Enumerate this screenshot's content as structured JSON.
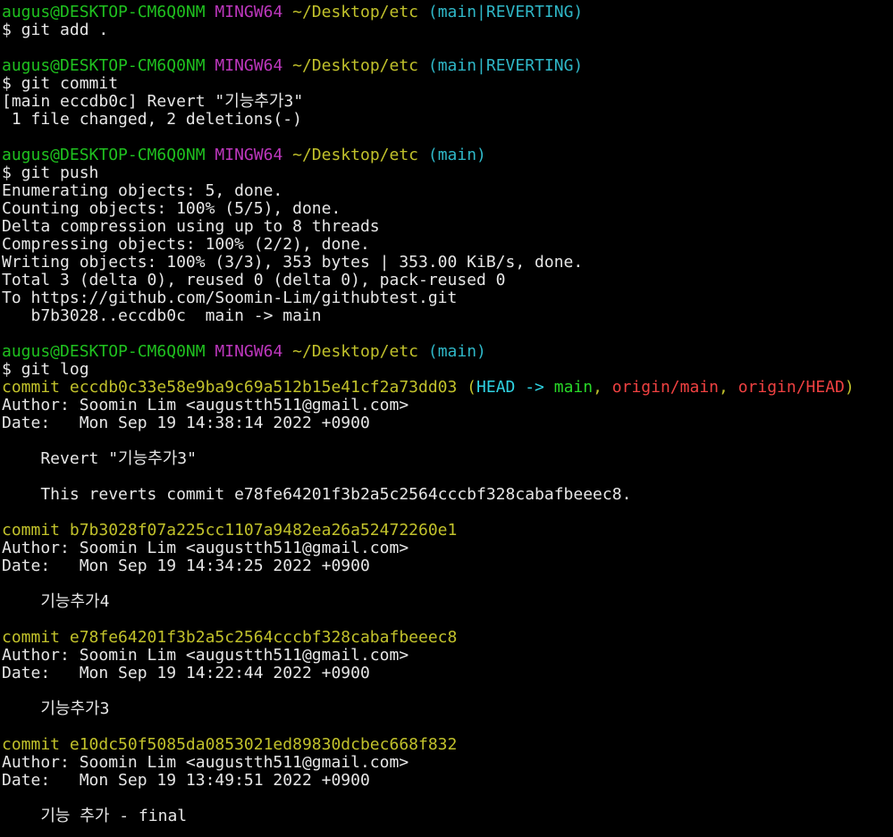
{
  "colors": {
    "user": "#1fc11f",
    "host": "#bd37bd",
    "path": "#c1c12b",
    "branch": "#2fb7c7",
    "hash": "#c1c12b",
    "text": "#e6e6e6",
    "head": "#2fd3e3",
    "local_branch": "#28d728",
    "remote_branch": "#ef4141",
    "background": "#000000"
  },
  "lines": [
    {
      "type": "prompt",
      "user": "augus@DESKTOP-CM6Q0NM",
      "host": "MINGW64",
      "path": "~/Desktop/etc",
      "branch": "(main|REVERTING)"
    },
    {
      "type": "text",
      "text": "$ git add ."
    },
    {
      "type": "blank"
    },
    {
      "type": "prompt",
      "user": "augus@DESKTOP-CM6Q0NM",
      "host": "MINGW64",
      "path": "~/Desktop/etc",
      "branch": "(main|REVERTING)"
    },
    {
      "type": "text",
      "text": "$ git commit"
    },
    {
      "type": "text",
      "text": "[main eccdb0c] Revert \"기능추가3\""
    },
    {
      "type": "text",
      "text": " 1 file changed, 2 deletions(-)"
    },
    {
      "type": "blank"
    },
    {
      "type": "prompt",
      "user": "augus@DESKTOP-CM6Q0NM",
      "host": "MINGW64",
      "path": "~/Desktop/etc",
      "branch": "(main)"
    },
    {
      "type": "text",
      "text": "$ git push"
    },
    {
      "type": "text",
      "text": "Enumerating objects: 5, done."
    },
    {
      "type": "text",
      "text": "Counting objects: 100% (5/5), done."
    },
    {
      "type": "text",
      "text": "Delta compression using up to 8 threads"
    },
    {
      "type": "text",
      "text": "Compressing objects: 100% (2/2), done."
    },
    {
      "type": "text",
      "text": "Writing objects: 100% (3/3), 353 bytes | 353.00 KiB/s, done."
    },
    {
      "type": "text",
      "text": "Total 3 (delta 0), reused 0 (delta 0), pack-reused 0"
    },
    {
      "type": "text",
      "text": "To https://github.com/Soomin-Lim/githubtest.git"
    },
    {
      "type": "text",
      "text": "   b7b3028..eccdb0c  main -> main"
    },
    {
      "type": "blank"
    },
    {
      "type": "prompt",
      "user": "augus@DESKTOP-CM6Q0NM",
      "host": "MINGW64",
      "path": "~/Desktop/etc",
      "branch": "(main)"
    },
    {
      "type": "text",
      "text": "$ git log"
    },
    {
      "type": "commit_head",
      "label": "commit eccdb0c33e58e9ba9c69a512b15e41cf2a73dd03",
      "open": " (",
      "head": "HEAD -> ",
      "local": "main",
      "sep1": ", ",
      "remote1": "origin/main",
      "sep2": ", ",
      "remote2": "origin/HEAD",
      "close": ")"
    },
    {
      "type": "text",
      "text": "Author: Soomin Lim <augustth511@gmail.com>"
    },
    {
      "type": "text",
      "text": "Date:   Mon Sep 19 14:38:14 2022 +0900"
    },
    {
      "type": "blank"
    },
    {
      "type": "text",
      "text": "    Revert \"기능추가3\""
    },
    {
      "type": "blank"
    },
    {
      "type": "text",
      "text": "    This reverts commit e78fe64201f3b2a5c2564cccbf328cabafbeeec8."
    },
    {
      "type": "blank"
    },
    {
      "type": "commit",
      "label": "commit b7b3028f07a225cc1107a9482ea26a52472260e1"
    },
    {
      "type": "text",
      "text": "Author: Soomin Lim <augustth511@gmail.com>"
    },
    {
      "type": "text",
      "text": "Date:   Mon Sep 19 14:34:25 2022 +0900"
    },
    {
      "type": "blank"
    },
    {
      "type": "text",
      "text": "    기능추가4"
    },
    {
      "type": "blank"
    },
    {
      "type": "commit",
      "label": "commit e78fe64201f3b2a5c2564cccbf328cabafbeeec8"
    },
    {
      "type": "text",
      "text": "Author: Soomin Lim <augustth511@gmail.com>"
    },
    {
      "type": "text",
      "text": "Date:   Mon Sep 19 14:22:44 2022 +0900"
    },
    {
      "type": "blank"
    },
    {
      "type": "text",
      "text": "    기능추가3"
    },
    {
      "type": "blank"
    },
    {
      "type": "commit",
      "label": "commit e10dc50f5085da0853021ed89830dcbec668f832"
    },
    {
      "type": "text",
      "text": "Author: Soomin Lim <augustth511@gmail.com>"
    },
    {
      "type": "text",
      "text": "Date:   Mon Sep 19 13:49:51 2022 +0900"
    },
    {
      "type": "blank"
    },
    {
      "type": "text",
      "text": "    기능 추가 - final"
    }
  ]
}
